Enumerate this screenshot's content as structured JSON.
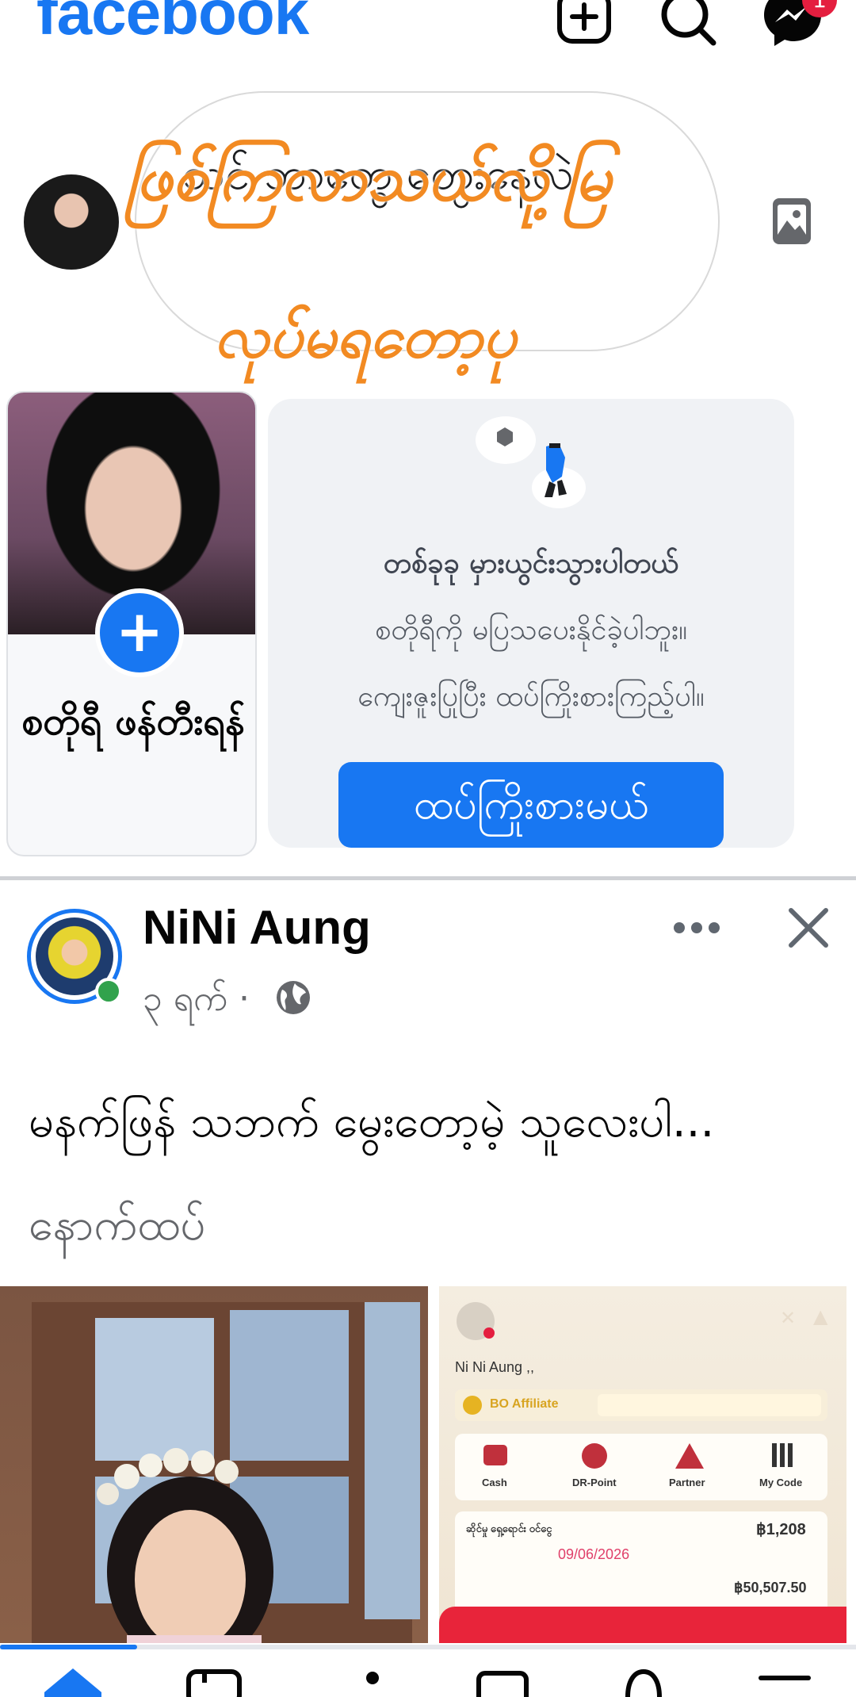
{
  "header": {
    "logo": "facebook",
    "icons": [
      "plus-square-icon",
      "search-icon",
      "messenger-icon"
    ],
    "messenger_badge": "1"
  },
  "composer": {
    "placeholder": "သင် ဘာတွေ တွေးနေလဲ",
    "overlay_line1": "ဖြစ်ကြလာသယ်လို့မြ",
    "overlay_line2": "လုပ်မရတော့ပု"
  },
  "stories": {
    "create": {
      "label": "စတိုရီ ဖန်တီးရန်"
    },
    "error": {
      "title": "တစ်ခုခု မှားယွင်းသွားပါတယ်",
      "line1": "စတိုရီကို မပြသပေးနိုင်ခဲ့ပါဘူး။",
      "line2": "ကျေးဇူးပြုပြီး ထပ်ကြိုးစားကြည့်ပါ။",
      "button": "ထပ်ကြိုးစားမယ်"
    }
  },
  "post": {
    "author": "NiNi Aung",
    "meta": "၃ ရက် ·",
    "text": "မနက်ဖြန် သဘက် မွေးတော့မဲ့ သူလေးပါ...",
    "see_more": "နောက်ထပ်",
    "screenshot": {
      "name": "Ni Ni Aung ,,",
      "affiliate": "BO Affiliate",
      "tiles": [
        "Cash",
        "DR-Point",
        "Partner",
        "My Code"
      ],
      "row1_label": "ဆိုင်မှု ရှေ့ရောင်း ဝင်ငွေ",
      "row1_value": "฿1,208",
      "row2_date": "09/06/2026",
      "row3_value": "฿50,507.50"
    }
  },
  "progress": {
    "fraction": 0.16
  },
  "bottom_nav": [
    "home-icon",
    "video-icon",
    "friends-icon",
    "marketplace-icon",
    "notifications-icon",
    "menu-icon"
  ],
  "colors": {
    "brand": "#1877f2",
    "overlay": "#f28a22",
    "online": "#31a24c"
  }
}
